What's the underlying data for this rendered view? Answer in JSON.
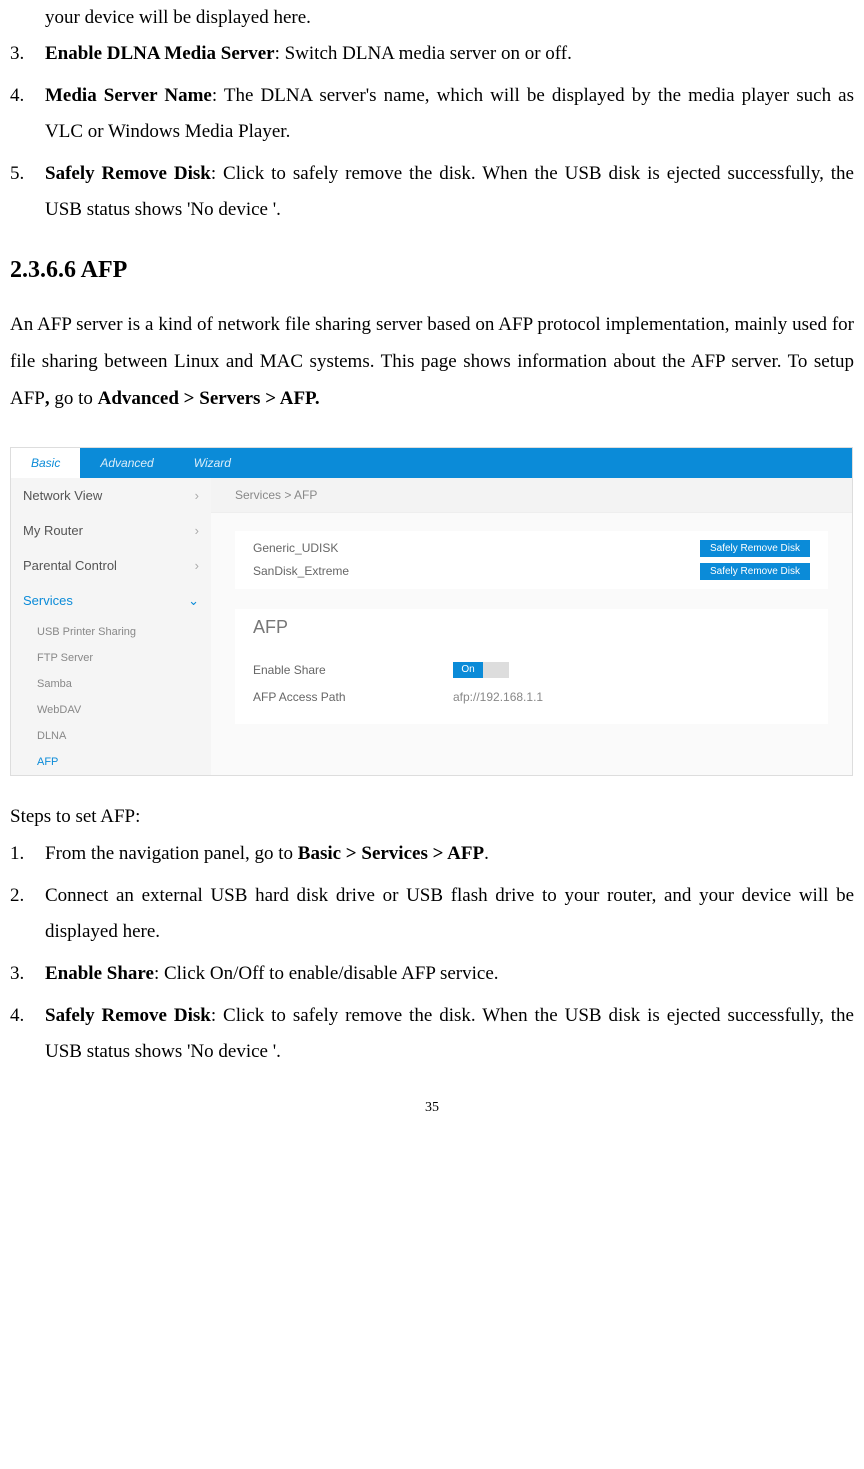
{
  "topList": [
    {
      "num": "",
      "text": "your device will be displayed here."
    },
    {
      "num": "3.",
      "bold": "Enable DLNA Media Server",
      "text": ": Switch DLNA media server on or off."
    },
    {
      "num": "4.",
      "bold": "Media Server Name",
      "text": ": The DLNA server's name, which will be displayed by the media player such as VLC or Windows Media Player."
    },
    {
      "num": "5.",
      "bold": "Safely Remove Disk",
      "text": ": Click to safely remove the disk. When the USB disk is ejected successfully, the USB status shows 'No device '."
    }
  ],
  "sectionHeading": "2.3.6.6 AFP",
  "afpParagraph": {
    "text1": "An AFP server is a kind of network file sharing server based on AFP protocol implementation, mainly used for file sharing between Linux and MAC systems. This page shows information about the AFP server. To setup AFP",
    "comma": ", ",
    "text2": "go to ",
    "bold": "Advanced > Servers > AFP."
  },
  "router": {
    "tabs": [
      "Basic",
      "Advanced",
      "Wizard"
    ],
    "sidebar": {
      "mainItems": [
        {
          "label": "Network View",
          "chev": "›"
        },
        {
          "label": "My Router",
          "chev": "›"
        },
        {
          "label": "Parental Control",
          "chev": "›"
        },
        {
          "label": "Services",
          "chev": "⌄",
          "selected": true
        }
      ],
      "subItems": [
        "USB Printer Sharing",
        "FTP Server",
        "Samba",
        "WebDAV",
        "DLNA",
        "AFP"
      ]
    },
    "breadcrumb": "Services > AFP",
    "disks": [
      {
        "name": "Generic_UDISK",
        "btn": "Safely Remove Disk"
      },
      {
        "name": "SanDisk_Extreme",
        "btn": "Safely Remove Disk"
      }
    ],
    "afp": {
      "title": "AFP",
      "enableLabel": "Enable Share",
      "toggleOn": "On",
      "pathLabel": "AFP Access Path",
      "pathValue": "afp://192.168.1.1"
    }
  },
  "stepsTitle": "Steps to set AFP:",
  "steps": [
    {
      "num": "1.",
      "text1": "From the navigation panel, go to ",
      "bold": "Basic > Services > AFP",
      "text2": "."
    },
    {
      "num": "2.",
      "text1": "Connect an external USB hard disk drive or USB flash drive to your router, and your device will be displayed here."
    },
    {
      "num": "3.",
      "bold": "Enable Share",
      "text2": ": Click On/Off to enable/disable AFP service."
    },
    {
      "num": "4.",
      "bold": "Safely Remove Disk",
      "text2": ": Click to safely remove the disk. When the USB disk is ejected successfully, the USB status shows 'No device '."
    }
  ],
  "pageNum": "35"
}
